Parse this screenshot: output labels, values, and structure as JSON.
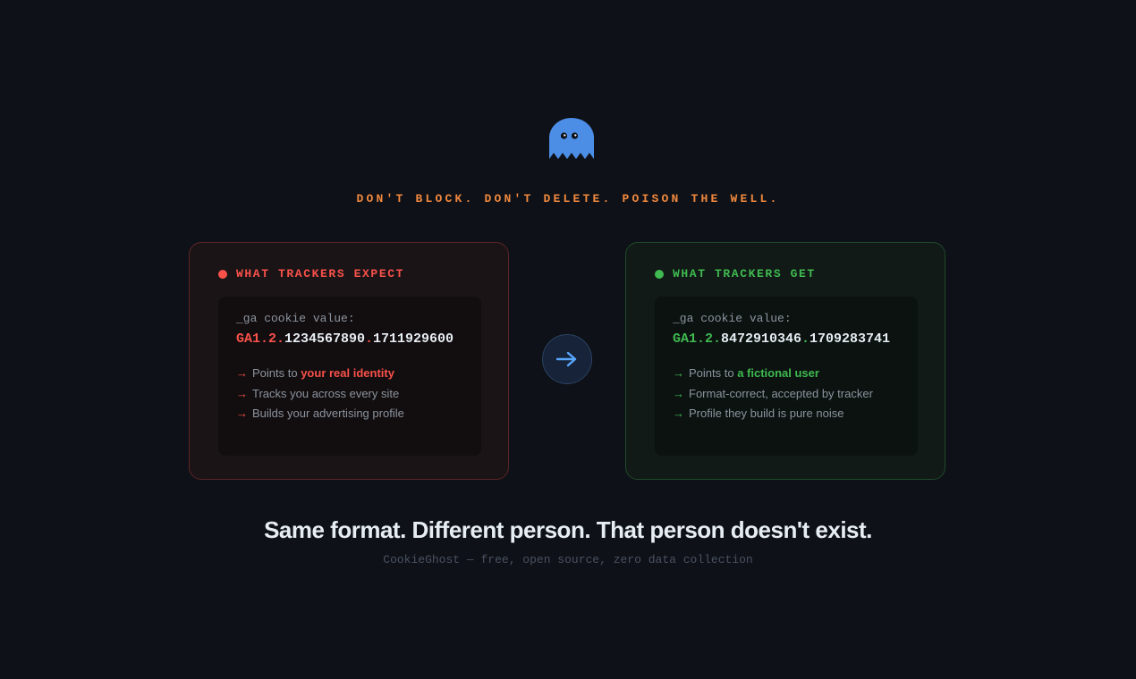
{
  "colors": {
    "background": "#0e1117",
    "accent_orange": "#f0883e",
    "danger_red": "#f85149",
    "success_green": "#3fb950",
    "ghost_blue": "#4c8ee6",
    "muted_text": "#8b949e"
  },
  "logo": {
    "icon": "ghost-icon"
  },
  "tagline": "DON'T BLOCK. DON'T DELETE. POISON THE WELL.",
  "cards": {
    "expect": {
      "title": "WHAT TRACKERS EXPECT",
      "cookie_label": "_ga cookie value:",
      "cookie_prefix": "GA1.2.",
      "cookie_id": "1234567890",
      "cookie_separator": ".",
      "cookie_timestamp": "1711929600",
      "points": [
        {
          "text": "Points to ",
          "emphasis": "your real identity"
        },
        {
          "text": "Tracks you across every site",
          "emphasis": ""
        },
        {
          "text": "Builds your advertising profile",
          "emphasis": ""
        }
      ]
    },
    "get": {
      "title": "WHAT TRACKERS GET",
      "cookie_label": "_ga cookie value:",
      "cookie_prefix": "GA1.2.",
      "cookie_id": "8472910346",
      "cookie_separator": ".",
      "cookie_timestamp": "1709283741",
      "points": [
        {
          "text": "Points to ",
          "emphasis": "a fictional user"
        },
        {
          "text": "Format-correct, accepted by tracker",
          "emphasis": ""
        },
        {
          "text": "Profile they build is pure noise",
          "emphasis": ""
        }
      ]
    }
  },
  "transition_icon": "arrow-right-icon",
  "arrow_glyph": "→",
  "headline": "Same format. Different person. That person doesn't exist.",
  "footnote": "CookieGhost — free, open source, zero data collection"
}
